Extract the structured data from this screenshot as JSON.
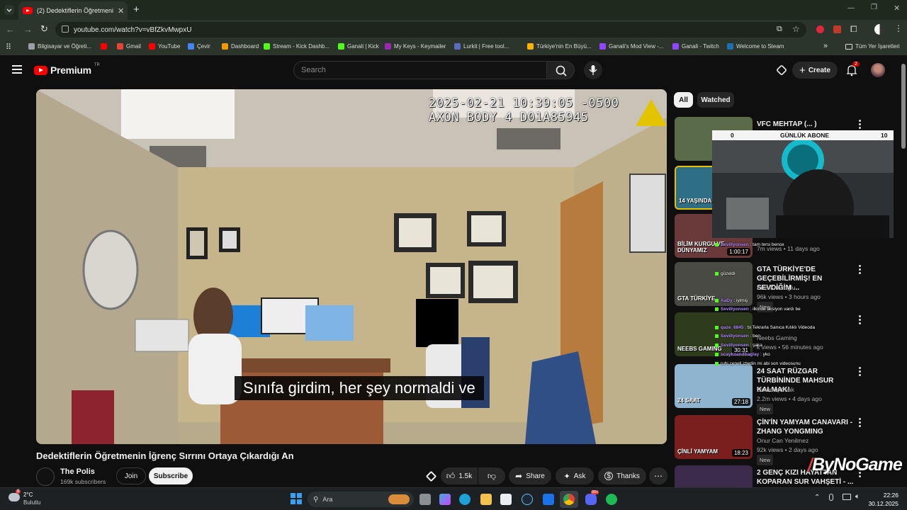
{
  "browser": {
    "tab_title": "(2) Dedektiflerin Öğretmenin İğ",
    "url": "youtube.com/watch?v=vBfZkvMwpxU",
    "bookmarks": [
      {
        "label": "Bilgisayar ve Öğreti...",
        "color": "#9aa0a6"
      },
      {
        "label": "",
        "color": "#ff0000"
      },
      {
        "label": "Gmail",
        "color": "#ea4335"
      },
      {
        "label": "YouTube",
        "color": "#ff0000"
      },
      {
        "label": "Çevir",
        "color": "#4285f4"
      },
      {
        "label": "Dashboard",
        "color": "#f29900"
      },
      {
        "label": "Stream - Kick Dashb...",
        "color": "#53fc18"
      },
      {
        "label": "Ganali | Kick",
        "color": "#53fc18"
      },
      {
        "label": "My Keys - Keymailer",
        "color": "#9c27b0"
      },
      {
        "label": "Lurkit | Free tool...",
        "color": "#5c6bc0"
      },
      {
        "label": "Türkiye'nin En Büyü...",
        "color": "#ffb300"
      },
      {
        "label": "Ganali's Mod View -...",
        "color": "#9146ff"
      },
      {
        "label": "Ganali - Twitch",
        "color": "#9146ff"
      },
      {
        "label": "Welcome to Steam",
        "color": "#1b6fb5"
      }
    ],
    "all_bookmarks": "Tüm Yer İşaretleri"
  },
  "youtube": {
    "logo": "Premium",
    "logo_sup": "TR",
    "search_placeholder": "Search",
    "create_label": "Create",
    "notif_count": "2"
  },
  "video": {
    "timestamp_line1": "2025-02-21 10:39:05 -0500",
    "timestamp_line2": "AXON BODY 4 D01A85945",
    "caption": "Sınıfa girdim, her şey normaldi ve",
    "title": "Dedektiflerin Öğretmenin İğrenç Sırrını Ortaya Çıkardığı An",
    "channel": "The Polis",
    "subscribers": "169k subscribers",
    "join_label": "Join",
    "subscribe_label": "Subscribe",
    "likes": "1.5k",
    "share_label": "Share",
    "ask_label": "Ask",
    "thanks_label": "Thanks"
  },
  "sidebar": {
    "chips": [
      "All",
      "Watched"
    ],
    "items": [
      {
        "title": "VFC MEHTAP (... )",
        "channel": "",
        "meta": "",
        "duration": "",
        "thumb_color": "#5a6b4a",
        "thumb_text": ""
      },
      {
        "title": "",
        "channel": "",
        "meta": "",
        "duration": "",
        "thumb_color": "#2f6f86",
        "thumb_text": "14 YAŞINDA"
      },
      {
        "title": "",
        "channel": "",
        "meta": "7m views • 11 days ago",
        "duration": "1:00:17",
        "thumb_color": "#6a3a3a",
        "thumb_text": "BİLİM KURGU VE DÜNYAMIZ"
      },
      {
        "title": "GTA TÜRKİYE'DE GEÇEBİLİRMİŞ! EN SEVDİĞİM ...",
        "channel": "Enis Kirazoglu",
        "meta": "96k views • 3 hours ago",
        "duration": "",
        "thumb_color": "#4a4a44",
        "thumb_text": "GTA TÜRKİYE",
        "badge": "New"
      },
      {
        "title": "",
        "channel": "Neebs Gaming",
        "meta": "k views • 56 minutes ago",
        "duration": "30:31",
        "thumb_color": "#2e3a1c",
        "thumb_text": "NEEBS GAMING"
      },
      {
        "title": "24 SAAT RÜZGAR TÜRBİNİNDE MAHSUR KALMAK!",
        "channel": "Orkun Işıtmak",
        "meta": "2.2m views • 4 days ago",
        "duration": "27:18",
        "thumb_color": "#8fb4cf",
        "thumb_text": "24 SAAT",
        "badge": "New"
      },
      {
        "title": "ÇİN'İN YAMYAM CANAVARI - ZHANG YONGMING",
        "channel": "Onur Can Yenilmez",
        "meta": "92k views • 2 days ago",
        "duration": "18:23",
        "thumb_color": "#7a1e1e",
        "thumb_text": "ÇİNLİ YAMYAM",
        "badge": "New"
      },
      {
        "title": "2 GENÇ KIZI HAYATTAN KOPARAN SUR VAHŞETİ - ...",
        "channel": "",
        "meta": "",
        "duration": "",
        "thumb_color": "#3b2a4a",
        "thumb_text": ""
      }
    ]
  },
  "stream_overlay": {
    "goal_label": "GÜNLÜK ABONE",
    "goal_current": "0",
    "goal_target": "10",
    "chat": [
      {
        "user": "Sevillyonsen",
        "msg": "tam tersi bence"
      },
      {
        "user": "",
        "msg": "güzeldi"
      },
      {
        "user": "AaDy",
        "msg": "iyimiş"
      },
      {
        "user": "Sevillyonsen",
        "msg": "ilkinde aksiyon vardı be"
      },
      {
        "user": "qaze_6845",
        "msg": "bi Tekrarla Sanıca Kılıklı Videoda"
      },
      {
        "user": "Sevillyonsen",
        "msg": "ben"
      },
      {
        "user": "Sevillyonsen",
        "msg": "şaka"
      },
      {
        "user": "scaykoandbaglay",
        "msg": "yko"
      },
      {
        "user": "",
        "msg": "ruhi çeneli izledin mi abi son videosunu"
      }
    ],
    "watermark": "ByNoGame"
  },
  "taskbar": {
    "weather_temp": "2°C",
    "weather_desc": "Bulutlu",
    "weather_badge": "8",
    "search_label": "Ara",
    "time": "22:26",
    "date": "30.12.2025",
    "discord_badge": "99+"
  }
}
